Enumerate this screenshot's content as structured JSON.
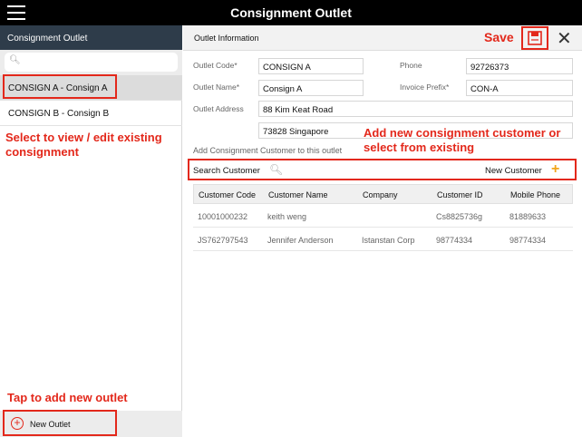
{
  "app_title": "Consignment Outlet",
  "sidebar": {
    "header": "Consignment Outlet",
    "outlets": [
      {
        "label": "CONSIGN A - Consign A"
      },
      {
        "label": "CONSIGN B - Consign B"
      }
    ],
    "footer_label": "New Outlet"
  },
  "annotations": {
    "select_hint": "Select to view / edit existing consignment",
    "tap_hint": "Tap to add new outlet",
    "save": "Save",
    "add_customer_hint": "Add new consignment customer or select from existing"
  },
  "main": {
    "title": "Outlet Information",
    "fields": {
      "outlet_code_label": "Outlet Code*",
      "outlet_code": "CONSIGN A",
      "outlet_name_label": "Outlet Name*",
      "outlet_name": "Consign A",
      "outlet_address_label": "Outlet Address",
      "address_line1": "88 Kim Keat Road",
      "address_line2": "73828 Singapore",
      "phone_label": "Phone",
      "phone": "92726373",
      "invoice_prefix_label": "Invoice Prefix*",
      "invoice_prefix": "CON-A"
    },
    "add_customer_text": "Add Consignment Customer to this outlet",
    "search_label": "Search Customer",
    "new_customer_label": "New Customer",
    "table": {
      "headers": [
        "Customer Code",
        "Customer Name",
        "Company",
        "Customer ID",
        "Mobile Phone"
      ],
      "rows": [
        [
          "10001000232",
          "keith weng",
          "",
          "Cs8825736g",
          "81889633"
        ],
        [
          "JS762797543",
          "Jennifer Anderson",
          "Istanstan Corp",
          "98774334",
          "98774334"
        ]
      ]
    }
  },
  "colors": {
    "annotation_red": "#e3281b",
    "sidebar_header": "#2e3c4a",
    "plus_orange": "#f2a51a"
  }
}
